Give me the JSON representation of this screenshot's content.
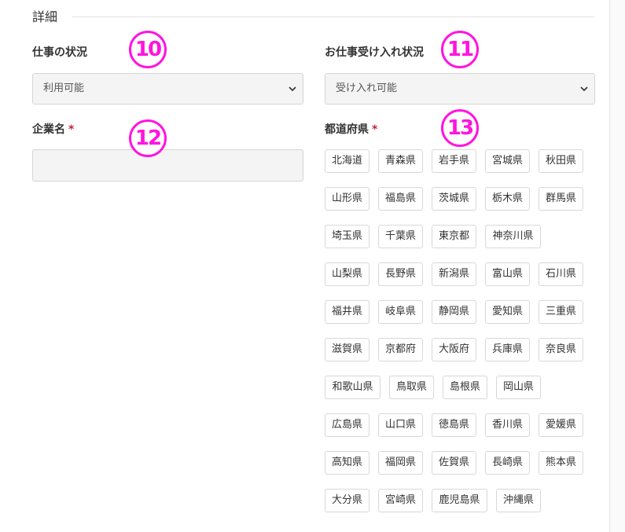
{
  "section": {
    "title": "詳細"
  },
  "job_status": {
    "label": "仕事の状況",
    "value": "利用可能"
  },
  "acceptance_status": {
    "label": "お仕事受け入れ状況",
    "value": "受け入れ可能"
  },
  "company": {
    "label": "企業名",
    "required_mark": "*",
    "value": ""
  },
  "prefecture": {
    "label": "都道府県",
    "required_mark": "*",
    "rows": [
      [
        "北海道",
        "青森県",
        "岩手県",
        "宮城県",
        "秋田県"
      ],
      [
        "山形県",
        "福島県",
        "茨城県",
        "栃木県",
        "群馬県"
      ],
      [
        "埼玉県",
        "千葉県",
        "東京都",
        "神奈川県"
      ],
      [
        "山梨県",
        "長野県",
        "新潟県",
        "富山県",
        "石川県"
      ],
      [
        "福井県",
        "岐阜県",
        "静岡県",
        "愛知県",
        "三重県"
      ],
      [
        "滋賀県",
        "京都府",
        "大阪府",
        "兵庫県",
        "奈良県"
      ],
      [
        "和歌山県",
        "鳥取県",
        "島根県",
        "岡山県"
      ],
      [
        "広島県",
        "山口県",
        "徳島県",
        "香川県",
        "愛媛県"
      ],
      [
        "高知県",
        "福岡県",
        "佐賀県",
        "長崎県",
        "熊本県"
      ],
      [
        "大分県",
        "宮崎県",
        "鹿児島県",
        "沖縄県"
      ]
    ]
  },
  "annotations": {
    "badge_10": "10",
    "badge_11": "11",
    "badge_12": "12",
    "badge_13": "13",
    "color": "#ff14e0"
  }
}
